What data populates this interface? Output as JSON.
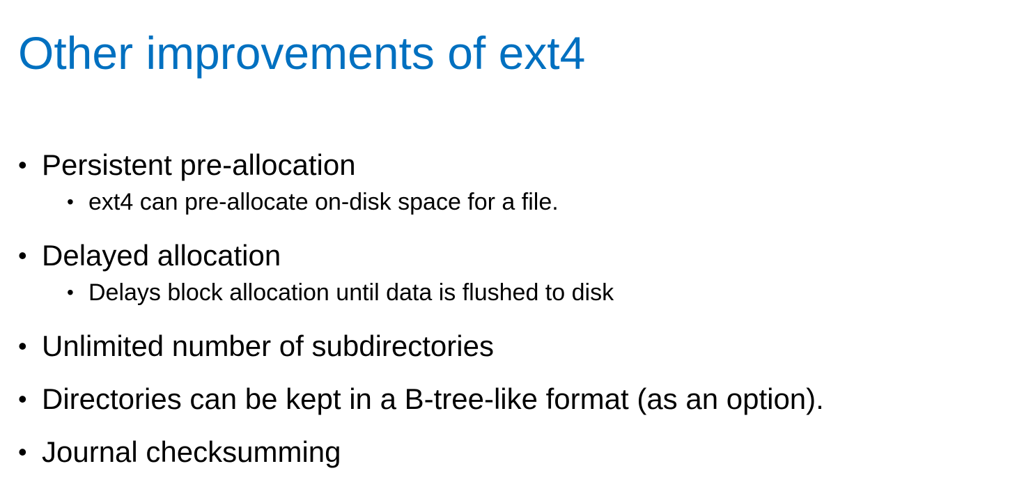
{
  "slide": {
    "title": "Other improvements of ext4",
    "bullet_glyph": "•",
    "items": [
      {
        "text": "Persistent pre-allocation",
        "sub": "ext4 can pre-allocate on-disk space for a file."
      },
      {
        "text": "Delayed allocation",
        "sub": "Delays block allocation until data is flushed to disk"
      },
      {
        "text": "Unlimited number of subdirectories"
      },
      {
        "text": "Directories can be kept in a B-tree-like format (as an option)."
      },
      {
        "text": "Journal checksumming"
      }
    ]
  },
  "colors": {
    "title": "#0070c0",
    "body_text": "#000000",
    "background": "#ffffff"
  }
}
